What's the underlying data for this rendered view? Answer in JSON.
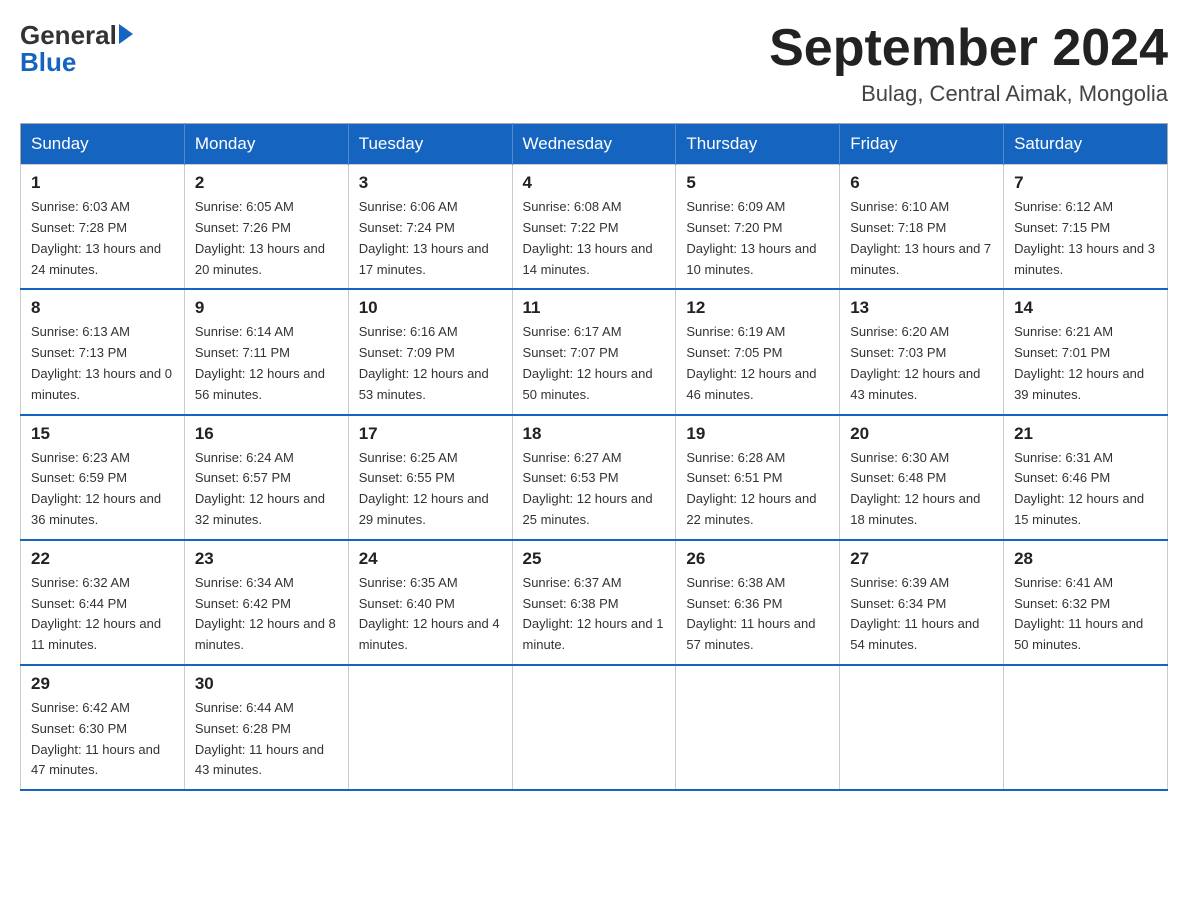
{
  "logo": {
    "general": "General",
    "blue": "Blue"
  },
  "title": "September 2024",
  "subtitle": "Bulag, Central Aimak, Mongolia",
  "headers": [
    "Sunday",
    "Monday",
    "Tuesday",
    "Wednesday",
    "Thursday",
    "Friday",
    "Saturday"
  ],
  "weeks": [
    [
      {
        "day": "1",
        "sunrise": "6:03 AM",
        "sunset": "7:28 PM",
        "daylight": "13 hours and 24 minutes."
      },
      {
        "day": "2",
        "sunrise": "6:05 AM",
        "sunset": "7:26 PM",
        "daylight": "13 hours and 20 minutes."
      },
      {
        "day": "3",
        "sunrise": "6:06 AM",
        "sunset": "7:24 PM",
        "daylight": "13 hours and 17 minutes."
      },
      {
        "day": "4",
        "sunrise": "6:08 AM",
        "sunset": "7:22 PM",
        "daylight": "13 hours and 14 minutes."
      },
      {
        "day": "5",
        "sunrise": "6:09 AM",
        "sunset": "7:20 PM",
        "daylight": "13 hours and 10 minutes."
      },
      {
        "day": "6",
        "sunrise": "6:10 AM",
        "sunset": "7:18 PM",
        "daylight": "13 hours and 7 minutes."
      },
      {
        "day": "7",
        "sunrise": "6:12 AM",
        "sunset": "7:15 PM",
        "daylight": "13 hours and 3 minutes."
      }
    ],
    [
      {
        "day": "8",
        "sunrise": "6:13 AM",
        "sunset": "7:13 PM",
        "daylight": "13 hours and 0 minutes."
      },
      {
        "day": "9",
        "sunrise": "6:14 AM",
        "sunset": "7:11 PM",
        "daylight": "12 hours and 56 minutes."
      },
      {
        "day": "10",
        "sunrise": "6:16 AM",
        "sunset": "7:09 PM",
        "daylight": "12 hours and 53 minutes."
      },
      {
        "day": "11",
        "sunrise": "6:17 AM",
        "sunset": "7:07 PM",
        "daylight": "12 hours and 50 minutes."
      },
      {
        "day": "12",
        "sunrise": "6:19 AM",
        "sunset": "7:05 PM",
        "daylight": "12 hours and 46 minutes."
      },
      {
        "day": "13",
        "sunrise": "6:20 AM",
        "sunset": "7:03 PM",
        "daylight": "12 hours and 43 minutes."
      },
      {
        "day": "14",
        "sunrise": "6:21 AM",
        "sunset": "7:01 PM",
        "daylight": "12 hours and 39 minutes."
      }
    ],
    [
      {
        "day": "15",
        "sunrise": "6:23 AM",
        "sunset": "6:59 PM",
        "daylight": "12 hours and 36 minutes."
      },
      {
        "day": "16",
        "sunrise": "6:24 AM",
        "sunset": "6:57 PM",
        "daylight": "12 hours and 32 minutes."
      },
      {
        "day": "17",
        "sunrise": "6:25 AM",
        "sunset": "6:55 PM",
        "daylight": "12 hours and 29 minutes."
      },
      {
        "day": "18",
        "sunrise": "6:27 AM",
        "sunset": "6:53 PM",
        "daylight": "12 hours and 25 minutes."
      },
      {
        "day": "19",
        "sunrise": "6:28 AM",
        "sunset": "6:51 PM",
        "daylight": "12 hours and 22 minutes."
      },
      {
        "day": "20",
        "sunrise": "6:30 AM",
        "sunset": "6:48 PM",
        "daylight": "12 hours and 18 minutes."
      },
      {
        "day": "21",
        "sunrise": "6:31 AM",
        "sunset": "6:46 PM",
        "daylight": "12 hours and 15 minutes."
      }
    ],
    [
      {
        "day": "22",
        "sunrise": "6:32 AM",
        "sunset": "6:44 PM",
        "daylight": "12 hours and 11 minutes."
      },
      {
        "day": "23",
        "sunrise": "6:34 AM",
        "sunset": "6:42 PM",
        "daylight": "12 hours and 8 minutes."
      },
      {
        "day": "24",
        "sunrise": "6:35 AM",
        "sunset": "6:40 PM",
        "daylight": "12 hours and 4 minutes."
      },
      {
        "day": "25",
        "sunrise": "6:37 AM",
        "sunset": "6:38 PM",
        "daylight": "12 hours and 1 minute."
      },
      {
        "day": "26",
        "sunrise": "6:38 AM",
        "sunset": "6:36 PM",
        "daylight": "11 hours and 57 minutes."
      },
      {
        "day": "27",
        "sunrise": "6:39 AM",
        "sunset": "6:34 PM",
        "daylight": "11 hours and 54 minutes."
      },
      {
        "day": "28",
        "sunrise": "6:41 AM",
        "sunset": "6:32 PM",
        "daylight": "11 hours and 50 minutes."
      }
    ],
    [
      {
        "day": "29",
        "sunrise": "6:42 AM",
        "sunset": "6:30 PM",
        "daylight": "11 hours and 47 minutes."
      },
      {
        "day": "30",
        "sunrise": "6:44 AM",
        "sunset": "6:28 PM",
        "daylight": "11 hours and 43 minutes."
      },
      null,
      null,
      null,
      null,
      null
    ]
  ]
}
